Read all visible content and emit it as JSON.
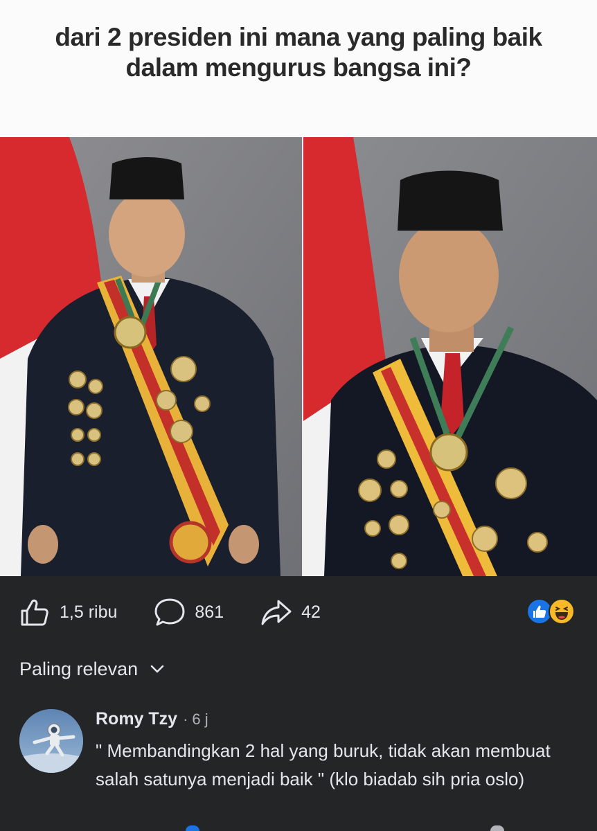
{
  "post": {
    "caption": "dari 2 presiden ini mana yang paling baik dalam mengurus bangsa ini?"
  },
  "stats": {
    "likes": "1,5 ribu",
    "comments": "861",
    "shares": "42"
  },
  "icons": {
    "like": "thumbs-up-icon",
    "comment": "speech-bubble-icon",
    "share": "share-arrow-icon",
    "like_reaction": "like-reaction-icon",
    "haha_reaction": "haha-reaction-icon",
    "sort_chevron": "chevron-down-icon"
  },
  "sort": {
    "label": "Paling relevan"
  },
  "comments": [
    {
      "author": "Romy Tzy",
      "separator": "·",
      "time": "6 j",
      "text": "\" Membandingkan 2 hal yang buruk, tidak akan membuat salah satunya menjadi baik \" (klo biadab sih pria oslo)"
    }
  ],
  "colors": {
    "background": "#242526",
    "text_primary": "#e4e6eb",
    "text_secondary": "#b0b3b8",
    "like_blue": "#1b74e4",
    "haha_yellow": "#f7b928",
    "flag_red": "#d62a2f"
  }
}
